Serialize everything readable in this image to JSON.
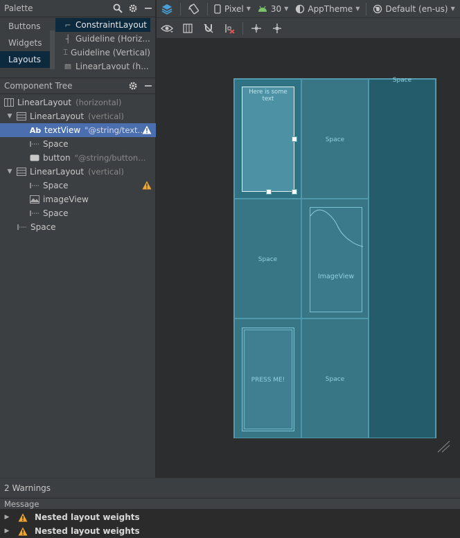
{
  "palette": {
    "title": "Palette",
    "categories": [
      "Buttons",
      "Widgets",
      "Layouts"
    ],
    "items": [
      "ConstraintLayout",
      "Guideline (Horiz...",
      "Guideline (Vertical)",
      "LinearLayout (h..."
    ]
  },
  "tree": {
    "title": "Component Tree",
    "rows": [
      {
        "label": "LinearLayout",
        "sub": "(horizontal)"
      },
      {
        "label": "LinearLayout",
        "sub": "(vertical)"
      },
      {
        "label": "textView",
        "sub": "\"@string/textV..."
      },
      {
        "label": "Space",
        "sub": ""
      },
      {
        "label": "button",
        "sub": "\"@string/buttonTe..."
      },
      {
        "label": "LinearLayout",
        "sub": "(vertical)"
      },
      {
        "label": "Space",
        "sub": ""
      },
      {
        "label": "imageView",
        "sub": ""
      },
      {
        "label": "Space",
        "sub": ""
      },
      {
        "label": "Space",
        "sub": ""
      }
    ]
  },
  "toolbar": {
    "device": "Pixel",
    "api": "30",
    "theme": "AppTheme",
    "locale": "Default (en-us)"
  },
  "design": {
    "text_view": "Here is some text",
    "space": "Space",
    "image_view": "ImageView",
    "button": "PRESS ME!"
  },
  "warnings": {
    "title": "2 Warnings",
    "column": "Message",
    "items": [
      "Nested layout weights",
      "Nested layout weights"
    ]
  },
  "colors": {
    "selection": "#4b6eaf",
    "device_bg": "#27616f",
    "warning": "#f0a732"
  }
}
